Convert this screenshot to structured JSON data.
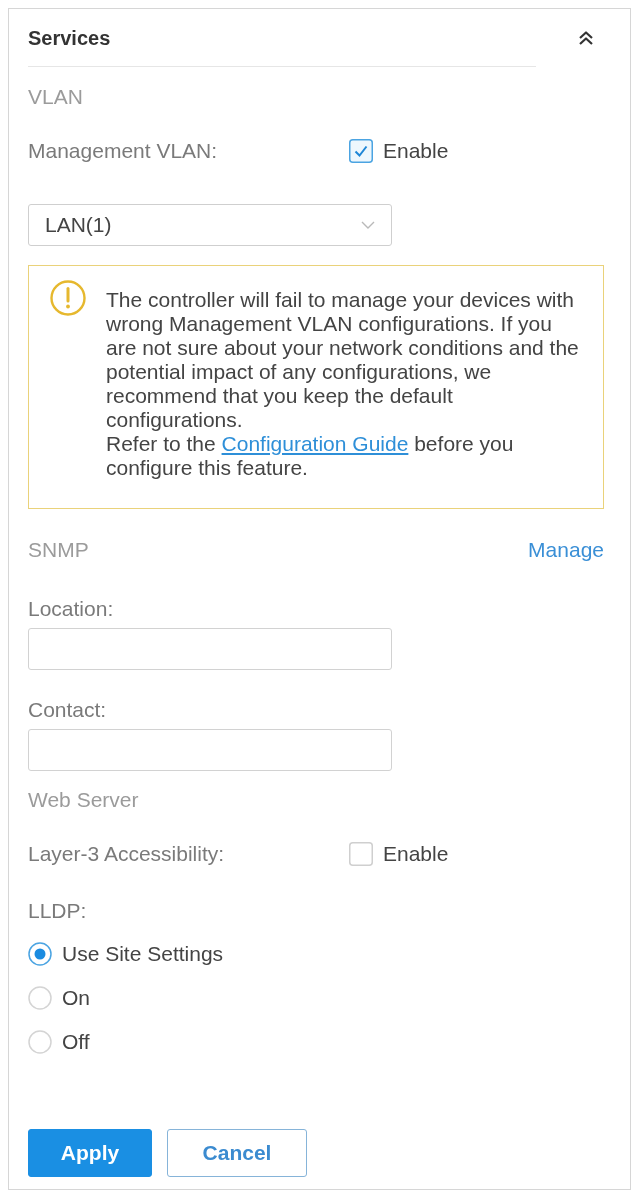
{
  "panel": {
    "title": "Services",
    "expanded": true
  },
  "vlan": {
    "heading": "VLAN",
    "management_vlan": {
      "label": "Management VLAN:",
      "checkbox_label": "Enable",
      "checked": true
    },
    "dropdown": {
      "value": "LAN(1)"
    },
    "warning": {
      "message": "The controller will fail to manage your devices with wrong Management VLAN configurations. If you are not sure about your network conditions and the potential impact of any configurations, we recommend that you keep the default configurations.",
      "refer_before": "Refer to the",
      "link": "Configuration Guide",
      "refer_after": "before you configure this feature."
    }
  },
  "snmp": {
    "heading": "SNMP",
    "manage_link": "Manage",
    "fields": [
      {
        "label": "Location:"
      },
      {
        "label": "Contact:"
      }
    ]
  },
  "web_server": {
    "heading": "Web Server",
    "layer3": {
      "label": "Layer-3 Accessibility:",
      "checkbox_label": "Enable",
      "checked": false
    }
  },
  "lldp": {
    "label": "LLDP:",
    "options": [
      {
        "label": "Use Site Settings",
        "selected": true
      },
      {
        "label": "On",
        "selected": false
      },
      {
        "label": "Off",
        "selected": false
      }
    ]
  },
  "buttons": [
    {
      "label": "Apply",
      "kind": "primary"
    },
    {
      "label": "Cancel",
      "kind": "secondary"
    }
  ]
}
